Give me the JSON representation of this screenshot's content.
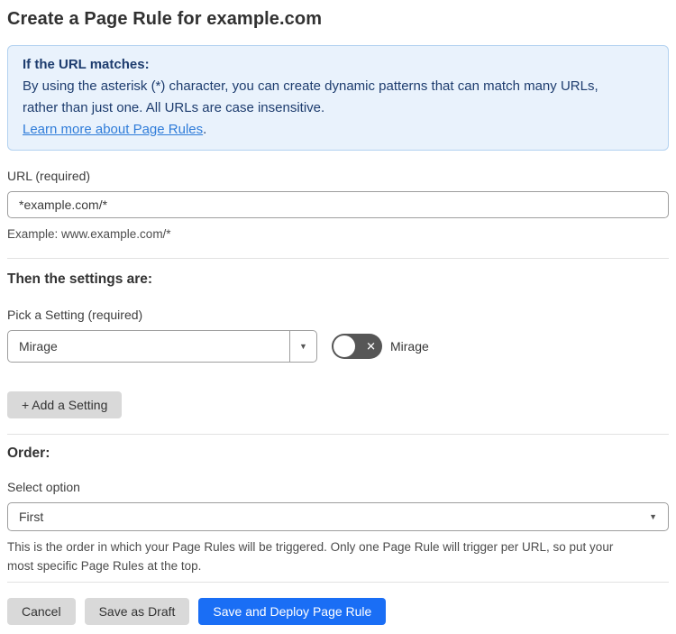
{
  "page": {
    "title": "Create a Page Rule for example.com"
  },
  "info_box": {
    "heading": "If the URL matches:",
    "body_lines": [
      "By using the asterisk (*) character, you can create dynamic patterns that can match many URLs,",
      "rather than just one. All URLs are case insensitive."
    ],
    "link_label": "Learn more about Page Rules",
    "link_suffix": "."
  },
  "url_field": {
    "label": "URL (required)",
    "value": "*example.com/*",
    "helper": "Example: www.example.com/*"
  },
  "settings_section": {
    "heading": "Then the settings are:",
    "picker_label": "Pick a Setting (required)",
    "selected_setting": "Mirage",
    "toggle": {
      "state": "off",
      "label": "Mirage"
    },
    "add_setting_label": "+ Add a Setting"
  },
  "order_section": {
    "heading": "Order:",
    "select_label": "Select option",
    "selected_option": "First",
    "helper_lines": [
      "This is the order in which your Page Rules will be triggered. Only one Page Rule will trigger per URL, so put your",
      "most specific Page Rules at the top."
    ]
  },
  "actions": {
    "cancel_label": "Cancel",
    "save_draft_label": "Save as Draft",
    "save_deploy_label": "Save and Deploy Page Rule"
  },
  "icons": {
    "dropdown_arrow": "▼",
    "toggle_off_x": "✕"
  },
  "colors": {
    "accent_blue": "#1a6ef5",
    "info_bg": "#e9f2fc",
    "info_border": "#b3d2f0",
    "info_text": "#1d3c6e",
    "link_blue": "#2f7cd9",
    "toggle_off_bg": "#565656"
  }
}
